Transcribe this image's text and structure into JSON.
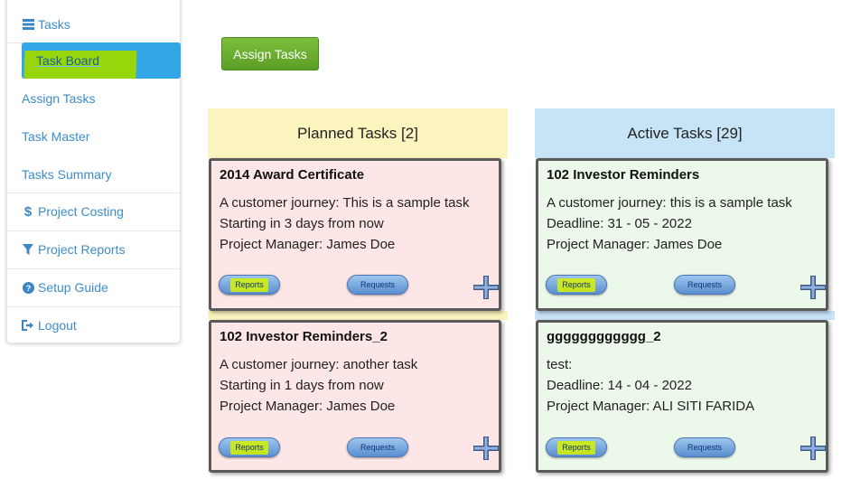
{
  "sidebar": {
    "tasks_label": "Tasks",
    "task_board_label": "Task Board",
    "assign_tasks_label": "Assign Tasks",
    "task_master_label": "Task Master",
    "tasks_summary_label": "Tasks Summary",
    "project_costing_label": "Project Costing",
    "project_reports_label": "Project Reports",
    "setup_guide_label": "Setup Guide",
    "logout_label": "Logout"
  },
  "toolbar": {
    "assign_button_label": "Assign Tasks"
  },
  "columns": {
    "planned": {
      "title": "Planned Tasks [2]",
      "cards": [
        {
          "title": "2014 Award Certificate",
          "line1": "A customer journey: This is a sample task",
          "line2": "Starting in 3 days from now",
          "line3": "Project Manager: James Doe",
          "reports_label": "Reports",
          "requests_label": "Requests"
        },
        {
          "title": "102 Investor Reminders_2",
          "line1": "A customer journey: another task",
          "line2": "Starting in 1 days from now",
          "line3": "Project Manager: James Doe",
          "reports_label": "Reports",
          "requests_label": "Requests"
        }
      ]
    },
    "active": {
      "title": "Active Tasks [29]",
      "cards": [
        {
          "title": "102 Investor Reminders",
          "line1": "A customer journey: this is a sample task",
          "line2": "Deadline: 31 - 05 - 2022",
          "line3": "Project Manager: James Doe",
          "reports_label": "Reports",
          "requests_label": "Requests"
        },
        {
          "title": "gggggggggggg_2",
          "line1": "test:",
          "line2": "Deadline: 14 - 04 - 2022",
          "line3": "Project Manager: ALI SITI FARIDA",
          "reports_label": "Reports",
          "requests_label": "Requests"
        }
      ]
    }
  },
  "colors": {
    "planned_header": "#fbf4bf",
    "active_header": "#c7e3f6",
    "planned_card": "#fde6e6",
    "active_card": "#ecf9ea",
    "accent": "#33a6e6",
    "highlight": "#9ed800",
    "assign_button": "#6aaf30"
  }
}
